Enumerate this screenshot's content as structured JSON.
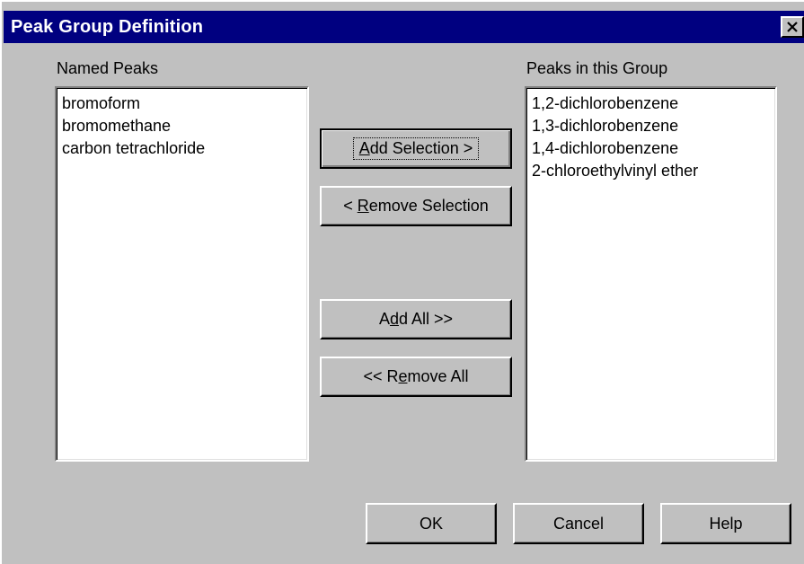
{
  "window": {
    "title": "Peak Group Definition",
    "close_glyph": "close-icon"
  },
  "named_peaks": {
    "label": "Named Peaks",
    "items": [
      "bromoform",
      "bromomethane",
      "carbon tetrachloride"
    ]
  },
  "group_peaks": {
    "label": "Peaks in this Group",
    "items": [
      "1,2-dichlorobenzene",
      "1,3-dichlorobenzene",
      "1,4-dichlorobenzene",
      "2-chloroethylvinyl ether"
    ]
  },
  "buttons": {
    "add_selection": {
      "pre": "",
      "mnemonic": "A",
      "post": "dd Selection >"
    },
    "remove_selection": {
      "pre": "< ",
      "mnemonic": "R",
      "post": "emove Selection"
    },
    "add_all": {
      "pre": "A",
      "mnemonic": "d",
      "post": "d All >>"
    },
    "remove_all": {
      "pre": "<< R",
      "mnemonic": "e",
      "post": "move All"
    },
    "ok": "OK",
    "cancel": "Cancel",
    "help": "Help"
  },
  "colors": {
    "face": "#c0c0c0",
    "titlebar": "#000080"
  }
}
